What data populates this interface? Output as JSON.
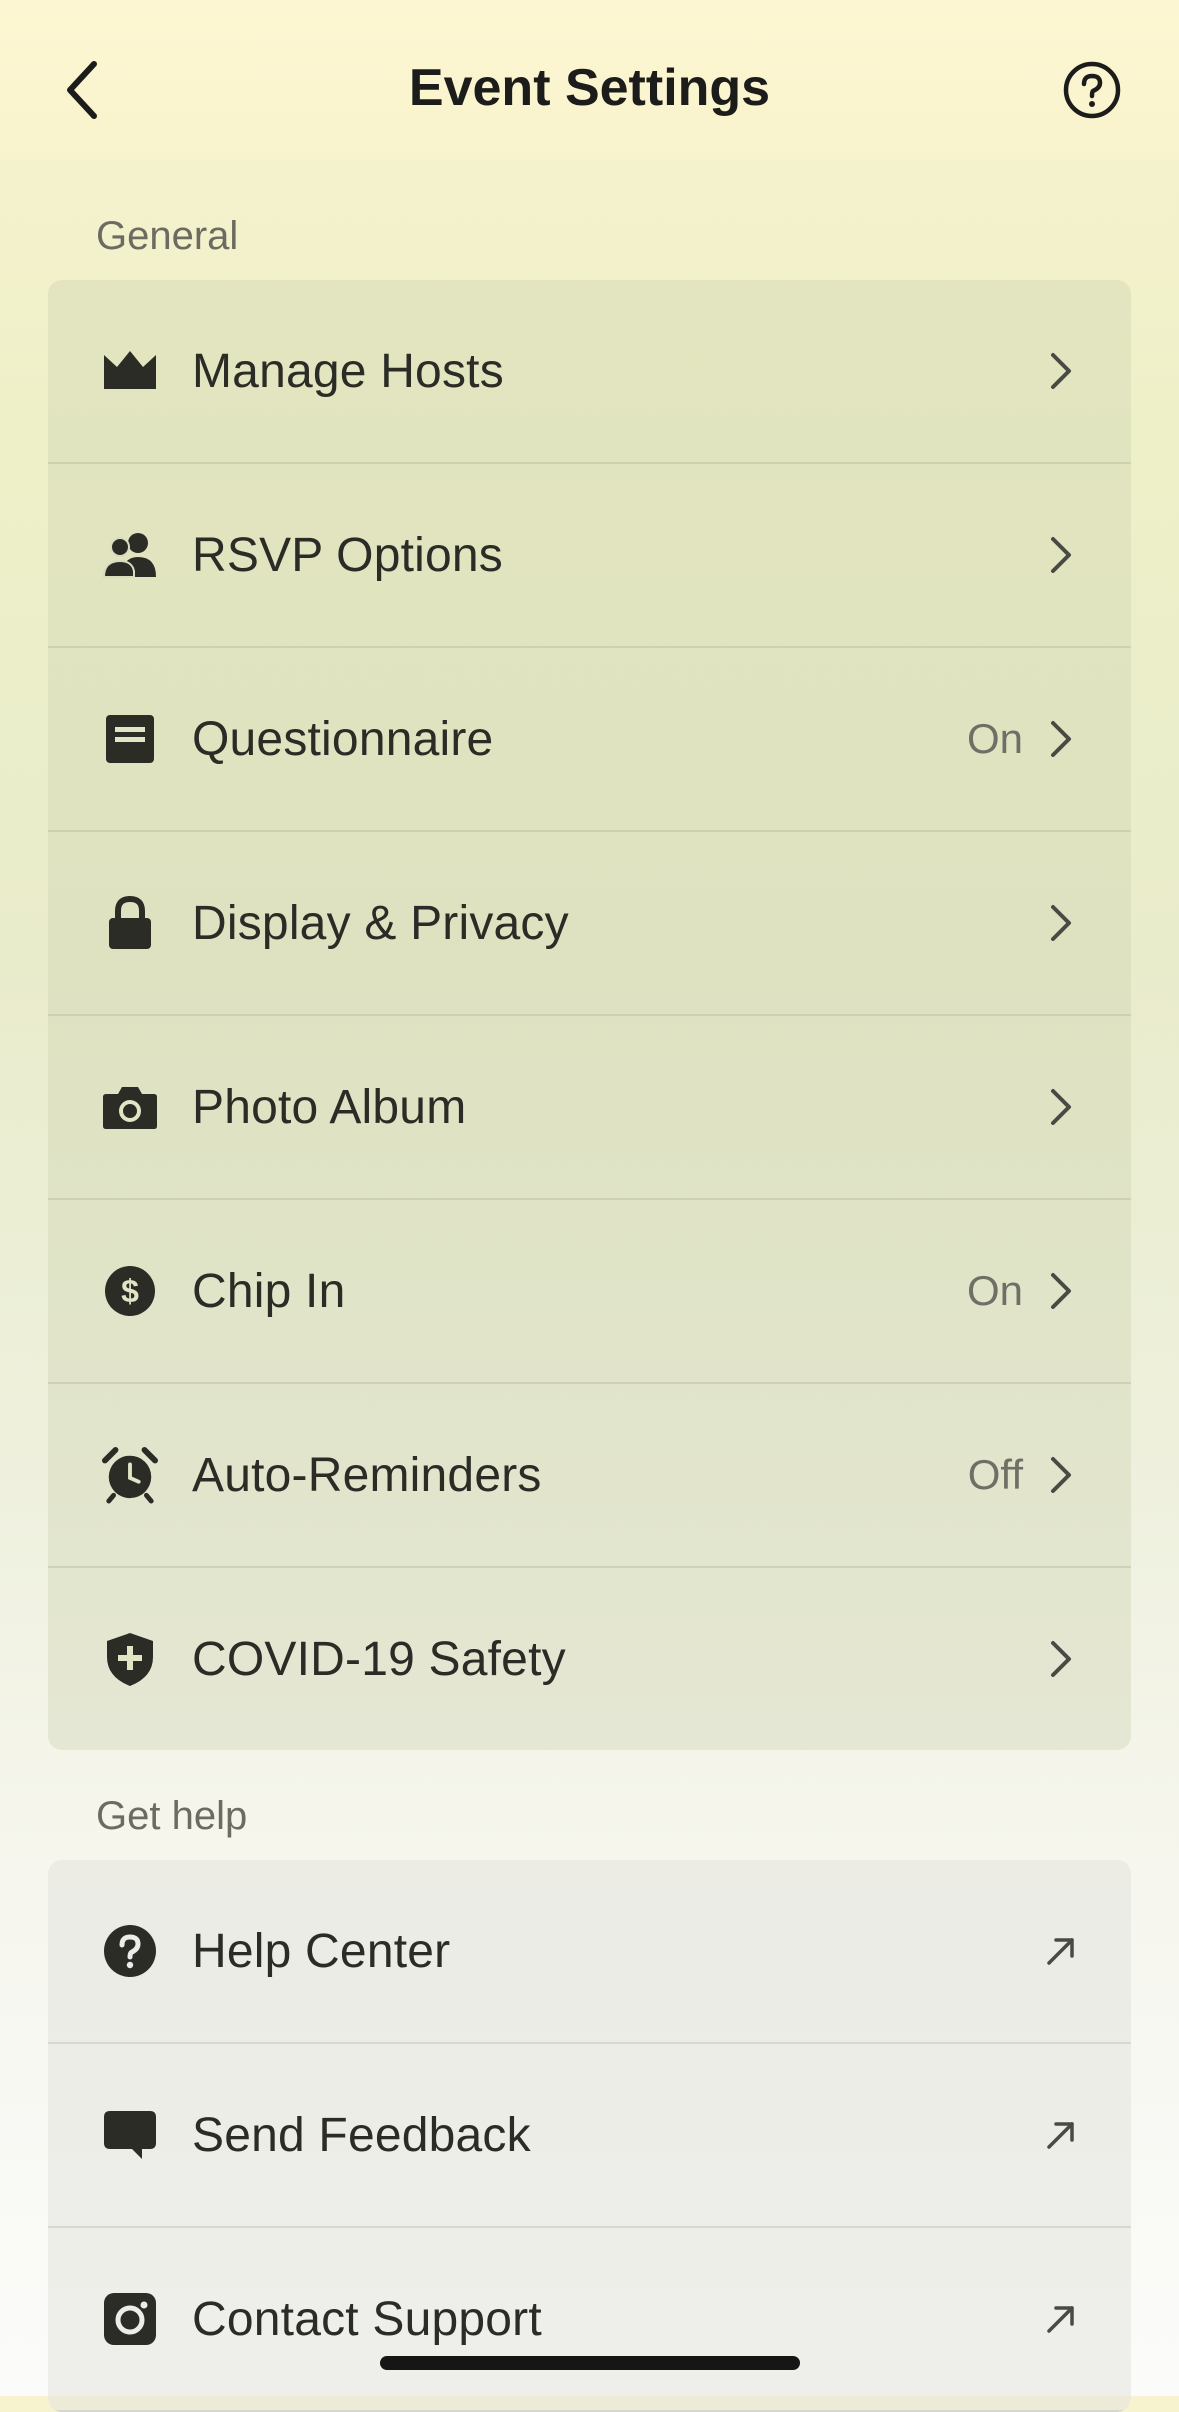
{
  "header": {
    "title": "Event Settings",
    "back_icon": "chevron-left-icon",
    "help_icon": "question-circle-icon"
  },
  "sections": {
    "general": {
      "label": "General",
      "items": [
        {
          "label": "Manage Hosts",
          "icon": "crown-icon",
          "status": ""
        },
        {
          "label": "RSVP Options",
          "icon": "people-icon",
          "status": ""
        },
        {
          "label": "Questionnaire",
          "icon": "form-icon",
          "status": "On"
        },
        {
          "label": "Display & Privacy",
          "icon": "lock-icon",
          "status": ""
        },
        {
          "label": "Photo Album",
          "icon": "camera-icon",
          "status": ""
        },
        {
          "label": "Chip In",
          "icon": "dollar-coin-icon",
          "status": "On"
        },
        {
          "label": "Auto-Reminders",
          "icon": "alarm-clock-icon",
          "status": "Off"
        },
        {
          "label": "COVID-19 Safety",
          "icon": "shield-plus-icon",
          "status": ""
        }
      ]
    },
    "get_help": {
      "label": "Get help",
      "items": [
        {
          "label": "Help Center",
          "icon": "question-circle-filled-icon"
        },
        {
          "label": "Send Feedback",
          "icon": "chat-bubble-icon"
        },
        {
          "label": "Contact Support",
          "icon": "instagram-icon"
        }
      ]
    }
  },
  "colors": {
    "text": "#2c2c27",
    "muted": "#6f6f66",
    "background_top": "#f8f3cf"
  }
}
